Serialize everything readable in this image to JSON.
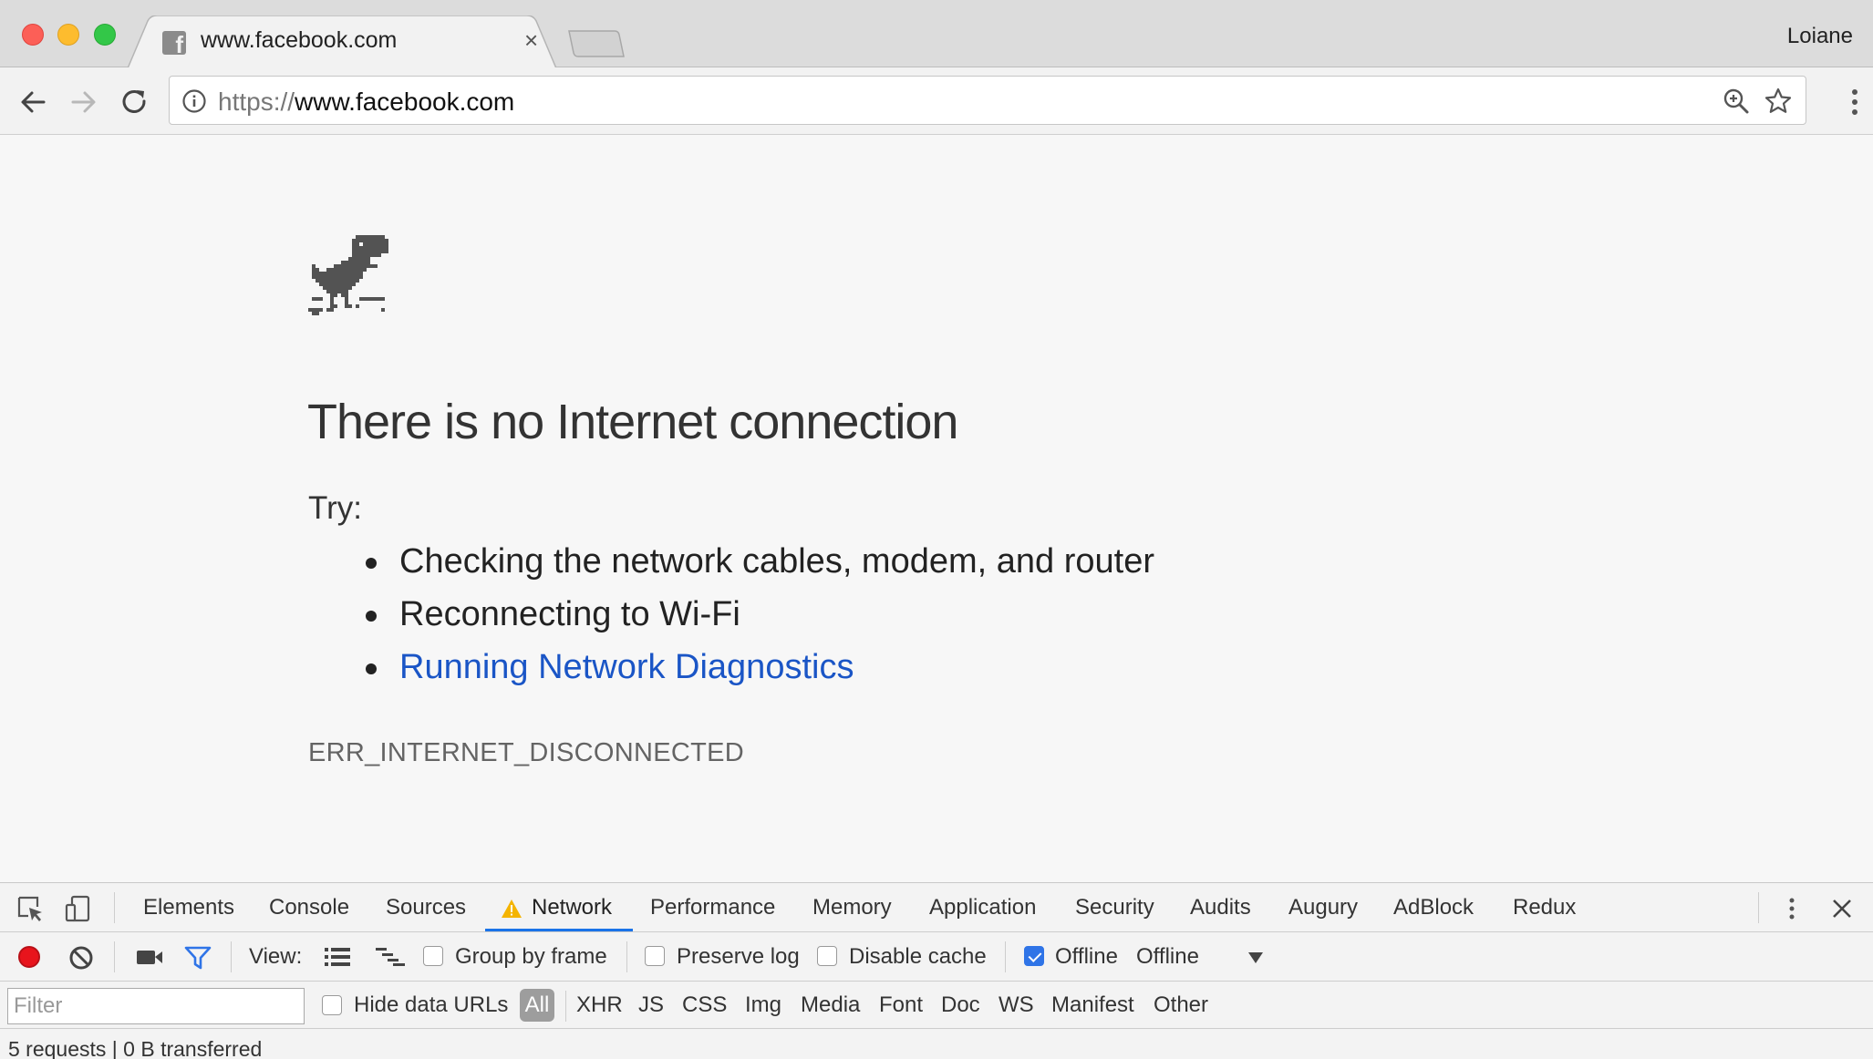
{
  "window": {
    "profile_name": "Loiane"
  },
  "tab": {
    "title": "www.facebook.com",
    "favicon": "facebook-icon",
    "close_glyph": "×"
  },
  "toolbar": {
    "url_scheme": "https://",
    "url_host": "www.facebook.com"
  },
  "error_page": {
    "heading": "There is no Internet connection",
    "try_label": "Try:",
    "suggestions": [
      "Checking the network cables, modem, and router",
      "Reconnecting to Wi-Fi",
      "Running Network Diagnostics"
    ],
    "error_code": "ERR_INTERNET_DISCONNECTED",
    "link_color": "#1a55c6"
  },
  "devtools": {
    "tabs": [
      "Elements",
      "Console",
      "Sources",
      "Network",
      "Performance",
      "Memory",
      "Application",
      "Security",
      "Audits",
      "Augury",
      "AdBlock",
      "Redux"
    ],
    "active_tab": "Network",
    "network_toolbar": {
      "view_label": "View:",
      "group_by_frame": "Group by frame",
      "preserve_log": "Preserve log",
      "disable_cache": "Disable cache",
      "offline_checkbox": "Offline",
      "offline_checked": true,
      "throttling_value": "Offline"
    },
    "filter": {
      "placeholder": "Filter",
      "hide_data_urls": "Hide data URLs",
      "types": [
        "All",
        "XHR",
        "JS",
        "CSS",
        "Img",
        "Media",
        "Font",
        "Doc",
        "WS",
        "Manifest",
        "Other"
      ],
      "active_type": "All"
    },
    "status": "5 requests | 0 B transferred"
  }
}
